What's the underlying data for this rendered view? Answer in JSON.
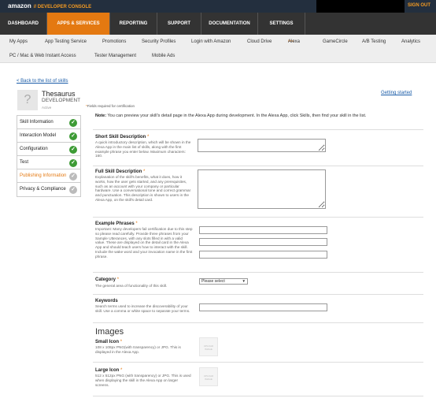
{
  "header": {
    "logo": "amazon",
    "console": "// DEVELOPER CONSOLE",
    "signout": "SIGN OUT"
  },
  "nav_main": [
    "DASHBOARD",
    "APPS & SERVICES",
    "REPORTING",
    "SUPPORT",
    "DOCUMENTATION",
    "SETTINGS"
  ],
  "nav_sub": {
    "row1": [
      "My Apps",
      "App Testing Service",
      "Promotions",
      "Security Profiles",
      "Login with Amazon",
      "Cloud Drive",
      "Alexa",
      "GameCircle",
      "A/B Testing",
      "Analytics"
    ],
    "alexa_badge": "New",
    "row2": [
      "PC / Mac & Web Instant Access",
      "Tester Management",
      "Mobile Ads"
    ]
  },
  "back_link": "< Back to the list of skills",
  "getting_started": "Getting started",
  "skill": {
    "icon": "?",
    "name": "Thesaurus",
    "stage": "DEVELOPMENT",
    "status": "Active"
  },
  "required_note": "Fields required for certification",
  "sidebar": [
    {
      "label": "Skill Information",
      "check": "✓"
    },
    {
      "label": "Interaction Model",
      "check": "✓"
    },
    {
      "label": "Configuration",
      "check": "✓"
    },
    {
      "label": "Test",
      "check": "✓"
    },
    {
      "label": "Publishing Information",
      "check": "✓"
    },
    {
      "label": "Privacy & Compliance",
      "check": "✓"
    }
  ],
  "note": {
    "bold": "Note:",
    "text": " You can preview your skill's detail page in the Alexa App during development. In the Alexa App, click Skills, then find your skill in the list."
  },
  "fields": {
    "short_desc": {
      "label": "Short Skill Description",
      "desc": "A quick introductory description, which will be shown in the Alexa App in the main list of skills, along with the first example phrase you enter below. Maximum characters: 160."
    },
    "full_desc": {
      "label": "Full Skill Description",
      "desc": "Explanation of the skill's benefits, what it does, how it works, how the user gets started, and any prerequisites, such as an account with your company or particular hardware. Use a conversational tone and correct grammar and punctuation. This description is shown to users in the Alexa App, on the skill's detail card."
    },
    "examples": {
      "label": "Example Phrases",
      "desc": "Important: Many developers fail certification due to this step so please read carefully. Provide three phrases from your Sample Utterances, with any slots filled in with a valid value. These are displayed on the detail card in the Alexa App and should teach users how to interact with the skill. Include the wake word and your invocation name in the first phrase."
    },
    "category": {
      "label": "Category",
      "desc": "The general area of functionality of this skill.",
      "value": "Please select"
    },
    "keywords": {
      "label": "Keywords",
      "desc": "Search terms used to increase the discoverability of your skill. Use a comma or white space to separate your terms."
    }
  },
  "images": {
    "heading": "Images",
    "small": {
      "label": "Small Icon",
      "desc": "108 x 108px PNG(with transparency) or JPG. This is displayed in the Alexa App."
    },
    "large": {
      "label": "Large Icon",
      "desc": "512 x 512px PNG (with transparency) or JPG. This is used when displaying the skill in the Alexa App on larger screens."
    },
    "placeholder": "UPLOAD IMAGE"
  },
  "colors": {
    "accent": "#e47911",
    "topbar": "#232f3e",
    "nav": "#333333",
    "check": "#3d9b35"
  }
}
